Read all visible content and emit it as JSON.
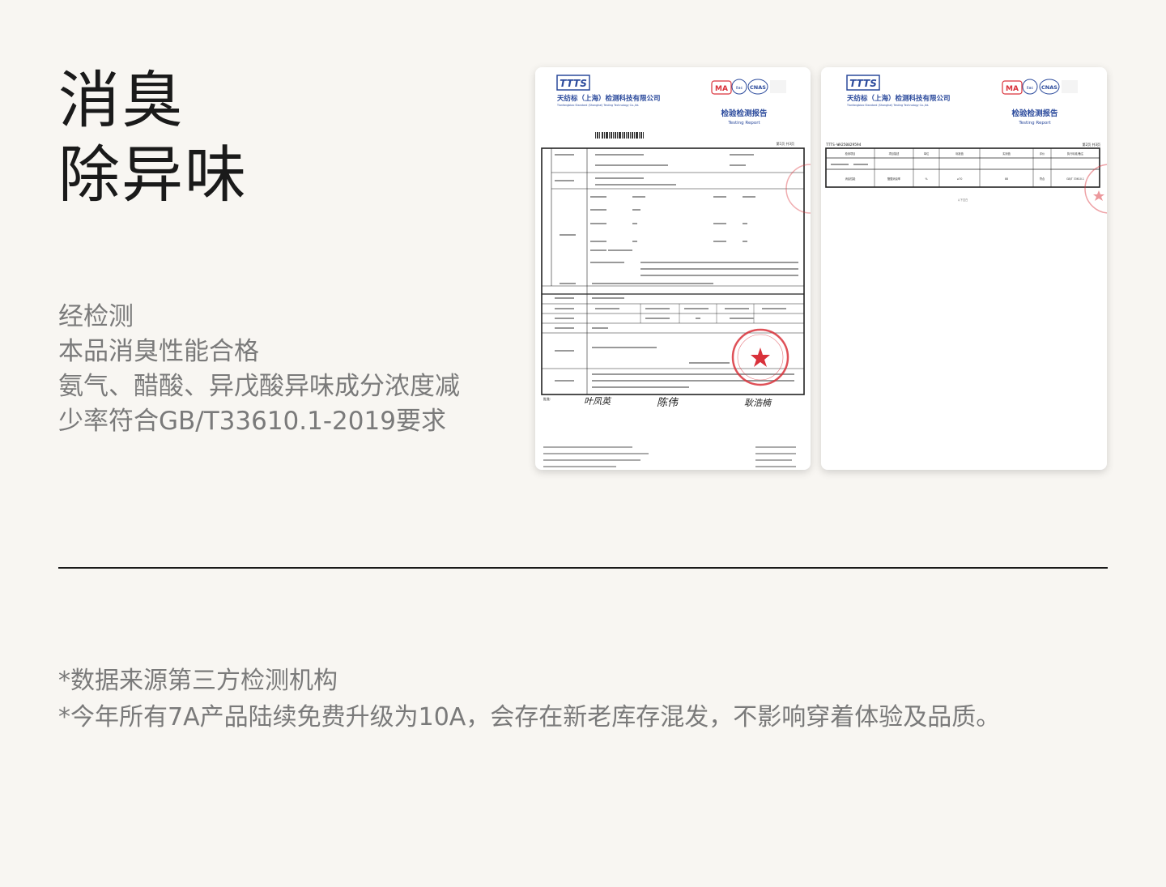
{
  "heading": {
    "line1": "消臭",
    "line2": "除异味"
  },
  "description": {
    "lines": [
      "经检测",
      "本品消臭性能合格",
      "氨气、醋酸、异戊酸异味成分浓度减",
      "少率符合GB/T33610.1-2019要求"
    ]
  },
  "report1": {
    "logo": "TTTS",
    "company_cn": "天纺标（上海）检测科技有限公司",
    "company_en": "Tianfangbiao Standard (Shanghai) Testing Technology Co.,ltd.",
    "cert_marks": [
      "MA",
      "ilac-MRA",
      "CNAS"
    ],
    "report_title_cn": "检验检测报告",
    "report_title_en": "Testing Report",
    "page": "第1页 共3页",
    "standard": "GB/T 33610.1-2019",
    "sample_name": "袜子",
    "stamp_color": "#d9313a",
    "signatures": [
      "叶凤英",
      "陈伟",
      "耿浩楠"
    ]
  },
  "report2": {
    "logo": "TTTS",
    "company_cn": "天纺标（上海）检测科技有限公司",
    "company_en": "Tianfangbiao Standard (Shanghai) Testing Technology Co.,ltd.",
    "cert_marks": [
      "MA",
      "ilac-MRA",
      "CNAS"
    ],
    "report_title_cn": "检验检测报告",
    "report_title_en": "Testing Report",
    "report_no": "TTTS-WH250029594",
    "page": "第2页 共3页",
    "columns": [
      "检测项目",
      "项目描述",
      "单位",
      "标准值",
      "实测值",
      "评价",
      "执行标准/备注"
    ],
    "row": [
      "消臭性能",
      "醋酸消臭率",
      "%",
      "≥70",
      "88",
      "符合",
      "GB/T 33610.1"
    ],
    "end_note": "以下空白"
  },
  "notes": {
    "line1": "*数据来源第三方检测机构",
    "line2": "*今年所有7A产品陆续免费升级为10A，会存在新老库存混发，不影响穿着体验及品质。"
  },
  "colors": {
    "background": "#f8f6f2",
    "heading": "#1a1a1a",
    "body_text": "#7a7a7a",
    "logo_blue": "#2b4a9c",
    "stamp_red": "#d9313a"
  }
}
